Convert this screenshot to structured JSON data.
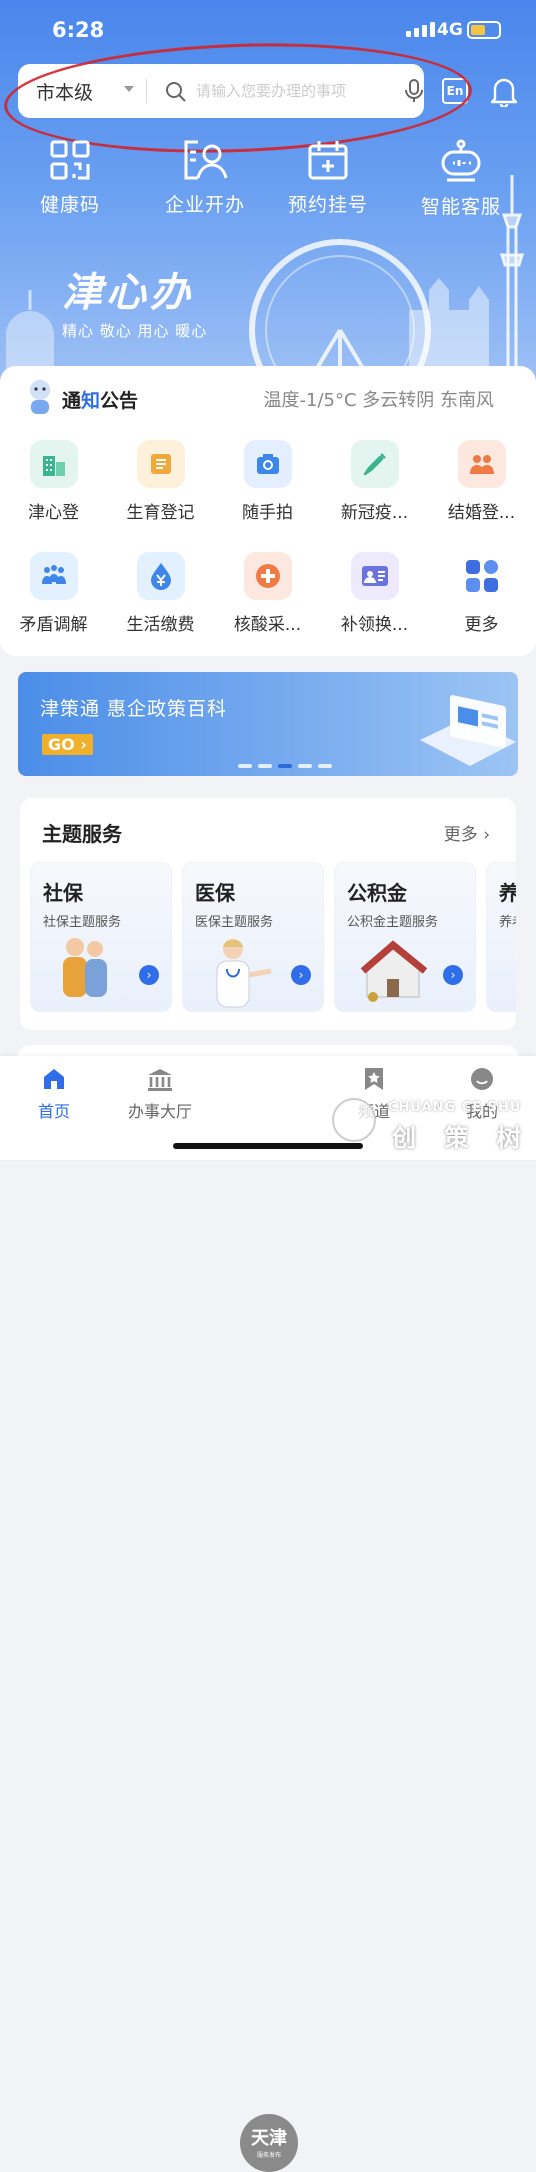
{
  "status": {
    "time": "6:28",
    "network": "4G"
  },
  "search": {
    "region": "市本级",
    "placeholder": "请输入您要办理的事项"
  },
  "header": {
    "lang_button": "En"
  },
  "quick_actions": [
    {
      "label": "健康码",
      "icon": "qr-code-icon"
    },
    {
      "label": "企业开办",
      "icon": "business-id-icon"
    },
    {
      "label": "预约挂号",
      "icon": "calendar-add-icon"
    },
    {
      "label": "智能客服",
      "icon": "robot-icon"
    }
  ],
  "brand": {
    "name": "津心办",
    "slogan": "精心 敬心 用心 暖心"
  },
  "notice": {
    "title_a": "通",
    "title_b": "知",
    "title_c": "公告",
    "weather": "温度-1/5°C 多云转阴 东南风"
  },
  "services": [
    [
      {
        "label": "津心登",
        "icon": "building-icon",
        "color": "#e4f5ef",
        "fg": "#3bb48f"
      },
      {
        "label": "生育登记",
        "icon": "document-icon",
        "color": "#fdf1dc",
        "fg": "#f2a93b"
      },
      {
        "label": "随手拍",
        "icon": "camera-icon",
        "color": "#e3efff",
        "fg": "#3d86ea"
      },
      {
        "label": "新冠疫...",
        "icon": "syringe-icon",
        "color": "#e4f5ef",
        "fg": "#3bb48f"
      },
      {
        "label": "结婚登...",
        "icon": "couple-icon",
        "color": "#fde8e0",
        "fg": "#f07a45"
      }
    ],
    [
      {
        "label": "矛盾调解",
        "icon": "people-icon",
        "color": "#e3f0ff",
        "fg": "#3d86ea"
      },
      {
        "label": "生活缴费",
        "icon": "yuan-drop-icon",
        "color": "#e3f0ff",
        "fg": "#3d86ea"
      },
      {
        "label": "核酸采...",
        "icon": "medical-cross-icon",
        "color": "#fde8e0",
        "fg": "#f07a45"
      },
      {
        "label": "补领换...",
        "icon": "id-card-icon",
        "color": "#eceafc",
        "fg": "#6a73e0"
      },
      {
        "label": "更多",
        "icon": "grid-more-icon",
        "color": "#ffffff",
        "fg": "#3d6fe0"
      }
    ]
  ],
  "banner": {
    "title": "津策通 惠企政策百科",
    "go": "GO"
  },
  "theme": {
    "title": "主题服务",
    "more": "更多",
    "cards": [
      {
        "title": "社保",
        "sub": "社保主题服务"
      },
      {
        "title": "医保",
        "sub": "医保主题服务"
      },
      {
        "title": "公积金",
        "sub": "公积金主题服务"
      },
      {
        "title": "养",
        "sub": "养老"
      }
    ]
  },
  "tabbar": {
    "tabs": [
      {
        "label": "首页"
      },
      {
        "label": "办事大厅"
      },
      {
        "label": "频道"
      },
      {
        "label": "我的"
      }
    ],
    "emblem_main": "天津",
    "emblem_sub": "服务发布"
  },
  "watermark": {
    "line1": "CHUANG CE SHU",
    "line2": "创 策 树"
  }
}
